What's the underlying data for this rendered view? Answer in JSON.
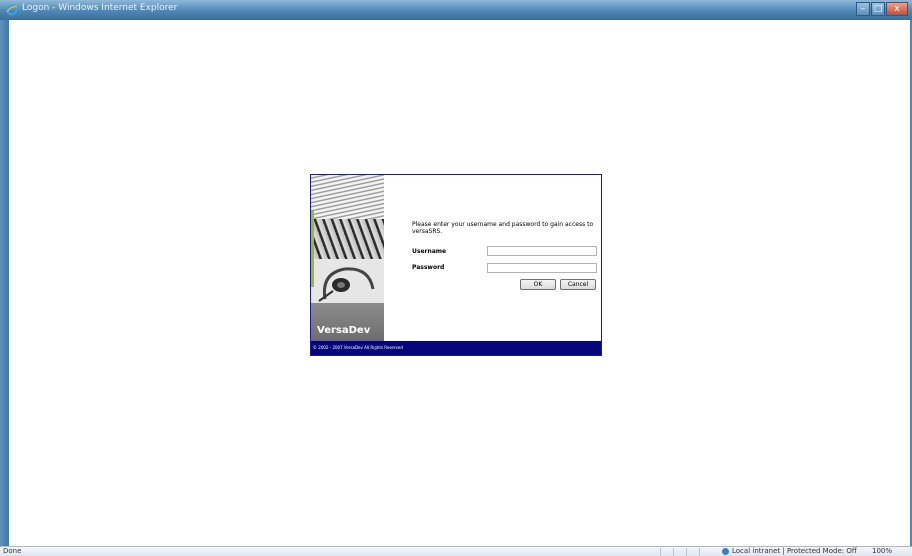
{
  "window": {
    "title": "Logon - Windows Internet Explorer",
    "controls": {
      "minimize": "–",
      "maximize": "□",
      "close": "x"
    }
  },
  "login": {
    "intro": "Please enter your username and password to gain access to versaSRS.",
    "username_label": "Username",
    "username_value": "",
    "password_label": "Password",
    "password_value": "",
    "ok_label": "OK",
    "cancel_label": "Cancel",
    "brand": "VersaDev",
    "copyright": "© 2002 - 2007 VersaDev All Rights Reserved"
  },
  "statusbar": {
    "status": "Done",
    "zone": "Local intranet | Protected Mode: Off",
    "zoom": "100%"
  },
  "colors": {
    "panel_border": "#1a1aa0",
    "footer": "#06067a",
    "accent_green": "#8fc31f",
    "frame": "#4f86b3"
  }
}
